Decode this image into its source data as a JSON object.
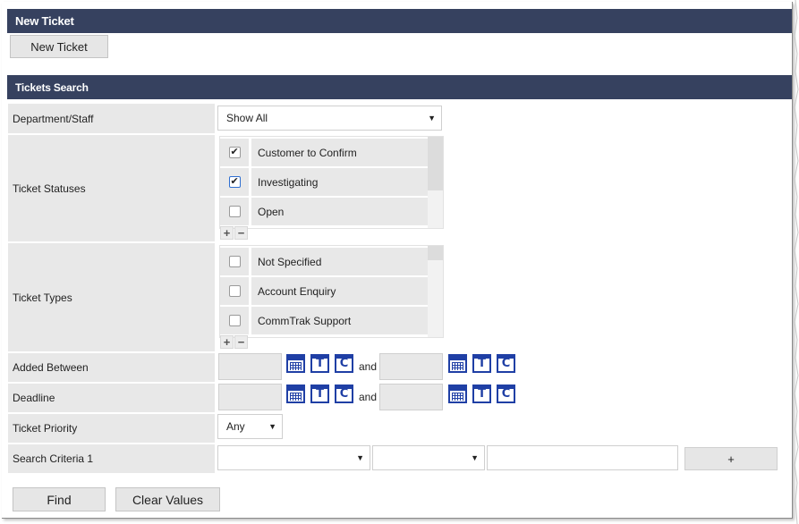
{
  "new_ticket_section": {
    "title": "New Ticket",
    "button_label": "New Ticket"
  },
  "search_section": {
    "title": "Tickets Search"
  },
  "fields": {
    "department": {
      "label": "Department/Staff",
      "value": "Show All"
    },
    "statuses": {
      "label": "Ticket Statuses",
      "items": [
        {
          "label": "Customer to Confirm",
          "checked": true
        },
        {
          "label": "Investigating",
          "checked": true
        },
        {
          "label": "Open",
          "checked": false
        }
      ]
    },
    "types": {
      "label": "Ticket Types",
      "items": [
        {
          "label": "Not Specified",
          "checked": false
        },
        {
          "label": "Account Enquiry",
          "checked": false
        },
        {
          "label": "CommTrak Support",
          "checked": false
        }
      ]
    },
    "added_between": {
      "label": "Added Between",
      "and_text": "and",
      "from_value": "",
      "to_value": ""
    },
    "deadline": {
      "label": "Deadline",
      "and_text": "and",
      "from_value": "",
      "to_value": ""
    },
    "priority": {
      "label": "Ticket Priority",
      "value": "Any"
    },
    "search_criteria": {
      "label": "Search Criteria 1",
      "value1": "",
      "value2": "",
      "text": "",
      "add_label": "+"
    }
  },
  "icons": {
    "calendar": "calendar-icon",
    "today": "T",
    "clear": "C",
    "plus": "+",
    "minus": "−",
    "dropdown": "▼"
  },
  "actions": {
    "find_label": "Find",
    "clear_label": "Clear Values"
  },
  "colors": {
    "header_bg": "#36415f",
    "label_bg": "#e8e8e8",
    "icon_blue": "#1f3fa5"
  }
}
